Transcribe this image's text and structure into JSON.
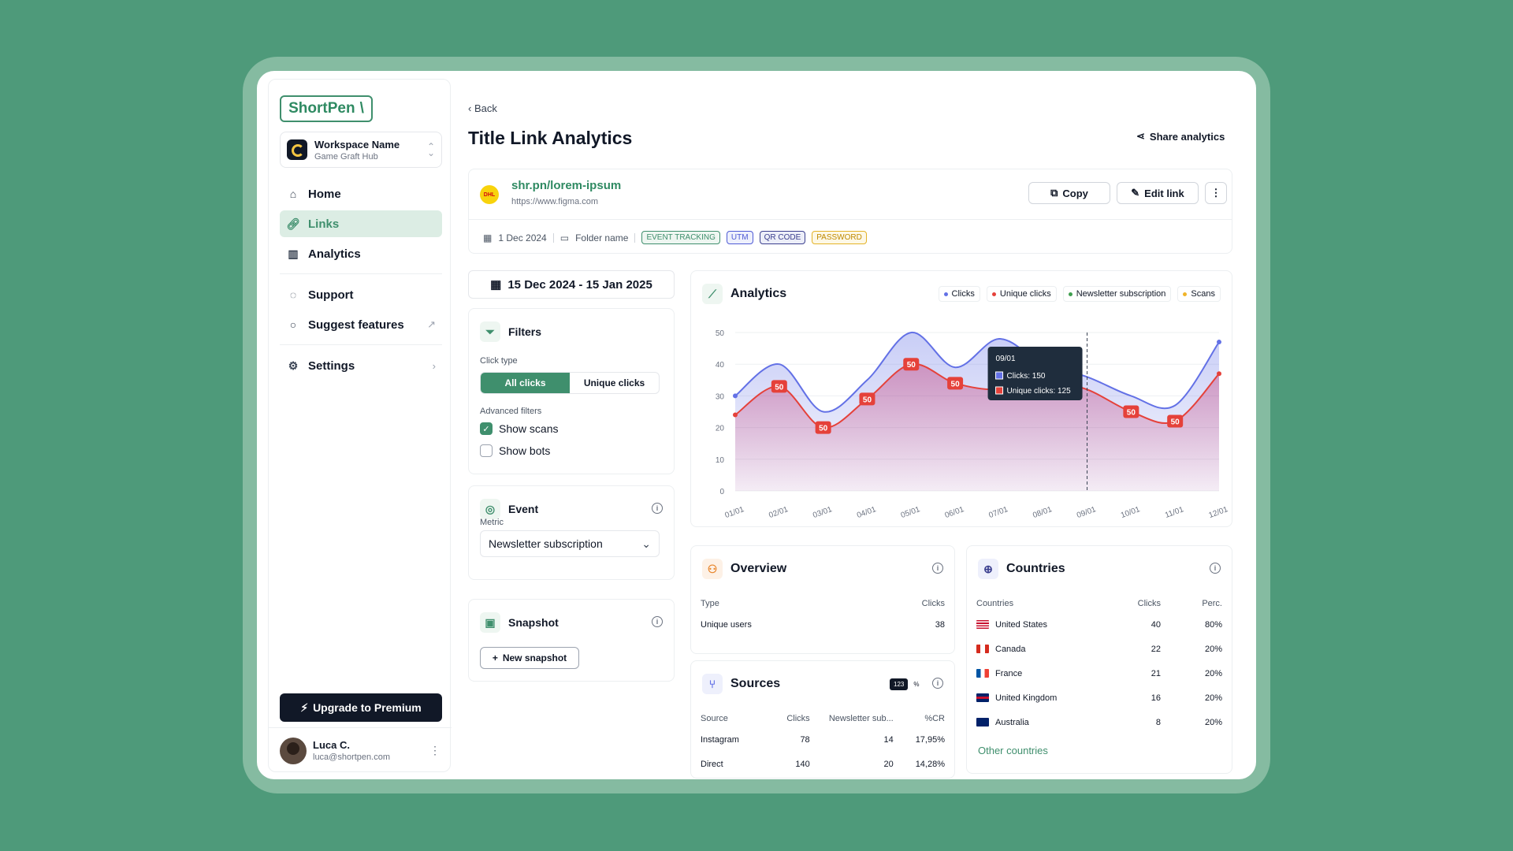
{
  "sidebar": {
    "logo": "ShortPen",
    "workspace": {
      "name": "Workspace Name",
      "sub": "Game Graft Hub"
    },
    "nav": [
      {
        "label": "Home",
        "icon": "home-icon"
      },
      {
        "label": "Links",
        "icon": "link-icon",
        "active": true
      },
      {
        "label": "Analytics",
        "icon": "bar-chart-icon"
      },
      {
        "label": "Support",
        "icon": "chat-icon"
      },
      {
        "label": "Suggest features",
        "icon": "lightbulb-icon"
      },
      {
        "label": "Settings",
        "icon": "gear-icon"
      }
    ],
    "upgrade": "Upgrade to Premium",
    "user": {
      "name": "Luca C.",
      "email": "luca@shortpen.com"
    }
  },
  "header": {
    "back": "Back",
    "title": "Title Link Analytics",
    "share": "Share analytics"
  },
  "link": {
    "short_url": "shr.pn/lorem-ipsum",
    "dest_url": "https://www.figma.com",
    "brand": "DHL",
    "copy": "Copy",
    "edit": "Edit link",
    "date": "1 Dec 2024",
    "folder": "Folder name",
    "tags": [
      "EVENT TRACKING",
      "UTM",
      "QR CODE",
      "PASSWORD"
    ]
  },
  "date_range": "15 Dec 2024 - 15 Jan 2025",
  "filters": {
    "title": "Filters",
    "click_type_label": "Click type",
    "all": "All clicks",
    "unique": "Unique clicks",
    "advanced_label": "Advanced filters",
    "show_scans": "Show scans",
    "show_bots": "Show bots"
  },
  "event": {
    "title": "Event",
    "metric_label": "Metric",
    "metric_value": "Newsletter subscription"
  },
  "snapshot": {
    "title": "Snapshot",
    "new": "New snapshot"
  },
  "analytics": {
    "title": "Analytics"
  },
  "chart_data": {
    "type": "area",
    "x": [
      "01/01",
      "02/01",
      "03/01",
      "04/01",
      "05/01",
      "06/01",
      "07/01",
      "08/01",
      "09/01",
      "10/01",
      "11/01",
      "12/01"
    ],
    "ylim": [
      0,
      50
    ],
    "yticks": [
      0,
      10,
      20,
      30,
      40,
      50
    ],
    "series": [
      {
        "name": "Clicks",
        "color": "#6371e6",
        "values": [
          30,
          40,
          25,
          35,
          50,
          39,
          48,
          40,
          36,
          30,
          27,
          47
        ]
      },
      {
        "name": "Unique clicks",
        "color": "#e5413a",
        "values": [
          24,
          33,
          20,
          29,
          40,
          34,
          32,
          35,
          32,
          25,
          22,
          37
        ]
      }
    ],
    "legend": [
      "Clicks",
      "Unique clicks",
      "Newsletter subscription",
      "Scans"
    ],
    "legend_colors": [
      "#6371e6",
      "#e5413a",
      "#3f9f4f",
      "#f0b429"
    ],
    "data_labels": [
      {
        "x": "02/01",
        "series": 1,
        "label": "50"
      },
      {
        "x": "03/01",
        "series": 1,
        "label": "50"
      },
      {
        "x": "04/01",
        "series": 1,
        "label": "50"
      },
      {
        "x": "05/01",
        "series": 1,
        "label": "50"
      },
      {
        "x": "06/01",
        "series": 1,
        "label": "50"
      },
      {
        "x": "10/01",
        "series": 1,
        "label": "50"
      },
      {
        "x": "11/01",
        "series": 1,
        "label": "50"
      }
    ],
    "tooltip": {
      "x": "09/01",
      "title": "09/01",
      "clicks": "Clicks: 150",
      "unique": "Unique clicks: 125"
    }
  },
  "overview": {
    "title": "Overview",
    "headers": [
      "Type",
      "Clicks"
    ],
    "rows": [
      [
        "Unique users",
        "38"
      ]
    ]
  },
  "sources": {
    "title": "Sources",
    "toggle": [
      "123",
      "%"
    ],
    "headers": [
      "Source",
      "Clicks",
      "Newsletter sub...",
      "%CR"
    ],
    "rows": [
      [
        "Instagram",
        "78",
        "14",
        "17,95%"
      ],
      [
        "Direct",
        "140",
        "20",
        "14,28%"
      ]
    ]
  },
  "countries": {
    "title": "Countries",
    "headers": [
      "Countries",
      "Clicks",
      "Perc."
    ],
    "rows": [
      [
        "United States",
        "40",
        "80%"
      ],
      [
        "Canada",
        "22",
        "20%"
      ],
      [
        "France",
        "21",
        "20%"
      ],
      [
        "United Kingdom",
        "16",
        "20%"
      ],
      [
        "Australia",
        "8",
        "20%"
      ]
    ],
    "other": "Other countries"
  }
}
